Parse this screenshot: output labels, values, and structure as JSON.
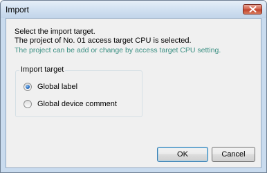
{
  "window": {
    "title": "Import"
  },
  "message": {
    "line1": "Select the import target.",
    "line2": "The project of No. 01 access target CPU is selected.",
    "line3": "The project can be add or change by access target CPU setting."
  },
  "import_target": {
    "group_label": "Import target",
    "options": [
      {
        "label": "Global label",
        "selected": true
      },
      {
        "label": "Global device comment",
        "selected": false
      }
    ]
  },
  "buttons": {
    "ok_label": "OK",
    "cancel_label": "Cancel"
  },
  "colors": {
    "hint_text": "#3a8f82",
    "close_button": "#c0432c"
  },
  "icons": {
    "close": "close-icon"
  }
}
